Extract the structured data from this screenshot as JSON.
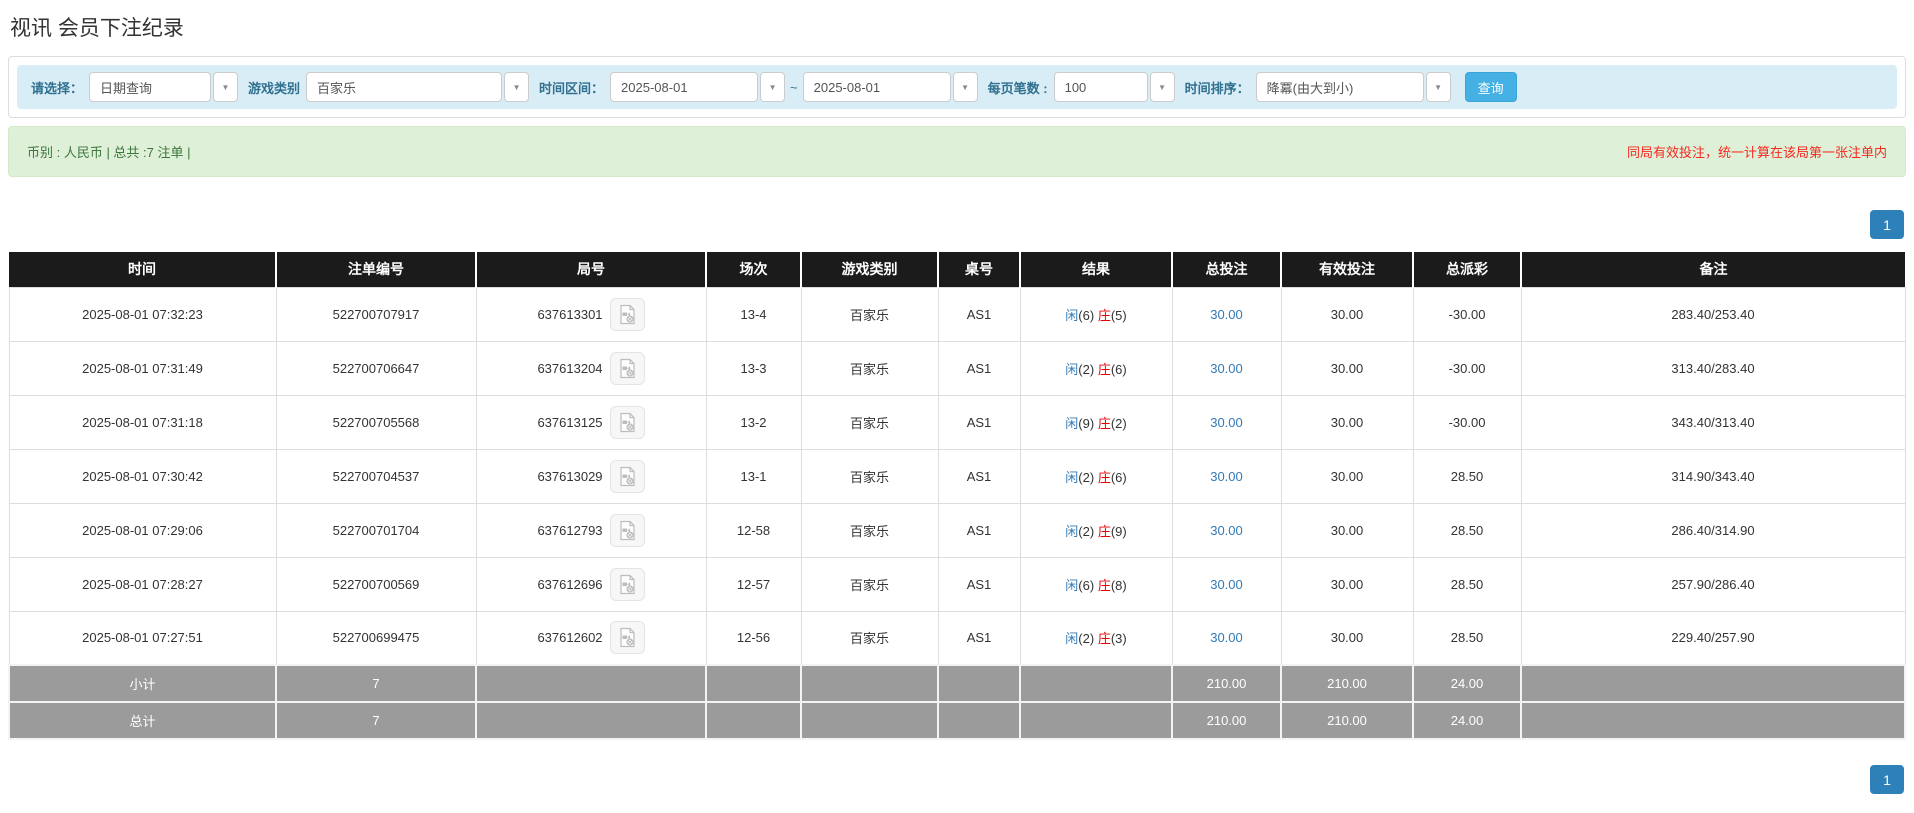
{
  "page": {
    "title": "视讯 会员下注纪录"
  },
  "filters": {
    "select_label": "请选择：",
    "select_value": "日期查询",
    "game_label": "游戏类别",
    "game_value": "百家乐",
    "range_label": "时间区间：",
    "date_from": "2025-08-01",
    "tilde": "~",
    "date_to": "2025-08-01",
    "per_page_label": "每页笔数 :",
    "per_page_value": "100",
    "sort_label": "时间排序：",
    "sort_value": "降冪(由大到小)",
    "search_button": "查询"
  },
  "summary_bar": {
    "left_text": "币别 : 人民币 | 总共 :7 注单 |",
    "right_note": "同局有效投注，统一计算在该局第一张注单内"
  },
  "pagination": {
    "page": "1"
  },
  "icons": {
    "dropdown_arrow": "▼",
    "video_replay": "film-document-icon"
  },
  "colors": {
    "header_bg": "#1b1b1b",
    "summary_row_bg": "#9b9b9b",
    "panel_blue": "#d9edf7",
    "label_blue": "#31708f",
    "link_blue": "#337ab7",
    "negative_red": "#e60000",
    "note_red": "#f5291f",
    "success_bg": "#dff0d8",
    "success_text": "#3c763d",
    "search_button_bg": "#45b0e3",
    "pagination_bg": "#2e80b9"
  },
  "table": {
    "headers": [
      "时间",
      "注单编号",
      "局号",
      "场次",
      "游戏类别",
      "桌号",
      "结果",
      "总投注",
      "有效投注",
      "总派彩",
      "备注"
    ],
    "rows": [
      {
        "time": "2025-08-01 07:32:23",
        "bet_id": "522700707917",
        "round_id": "637613301",
        "session": "13-4",
        "game_type": "百家乐",
        "table_no": "AS1",
        "player": "闲",
        "player_n": "(6)",
        "banker": "庄",
        "banker_n": "(5)",
        "total_bet": "30.00",
        "valid_bet": "30.00",
        "payout": "-30.00",
        "note": "283.40/253.40"
      },
      {
        "time": "2025-08-01 07:31:49",
        "bet_id": "522700706647",
        "round_id": "637613204",
        "session": "13-3",
        "game_type": "百家乐",
        "table_no": "AS1",
        "player": "闲",
        "player_n": "(2)",
        "banker": "庄",
        "banker_n": "(6)",
        "total_bet": "30.00",
        "valid_bet": "30.00",
        "payout": "-30.00",
        "note": "313.40/283.40"
      },
      {
        "time": "2025-08-01 07:31:18",
        "bet_id": "522700705568",
        "round_id": "637613125",
        "session": "13-2",
        "game_type": "百家乐",
        "table_no": "AS1",
        "player": "闲",
        "player_n": "(9)",
        "banker": "庄",
        "banker_n": "(2)",
        "total_bet": "30.00",
        "valid_bet": "30.00",
        "payout": "-30.00",
        "note": "343.40/313.40"
      },
      {
        "time": "2025-08-01 07:30:42",
        "bet_id": "522700704537",
        "round_id": "637613029",
        "session": "13-1",
        "game_type": "百家乐",
        "table_no": "AS1",
        "player": "闲",
        "player_n": "(2)",
        "banker": "庄",
        "banker_n": "(6)",
        "total_bet": "30.00",
        "valid_bet": "30.00",
        "payout": "28.50",
        "note": "314.90/343.40"
      },
      {
        "time": "2025-08-01 07:29:06",
        "bet_id": "522700701704",
        "round_id": "637612793",
        "session": "12-58",
        "game_type": "百家乐",
        "table_no": "AS1",
        "player": "闲",
        "player_n": "(2)",
        "banker": "庄",
        "banker_n": "(9)",
        "total_bet": "30.00",
        "valid_bet": "30.00",
        "payout": "28.50",
        "note": "286.40/314.90"
      },
      {
        "time": "2025-08-01 07:28:27",
        "bet_id": "522700700569",
        "round_id": "637612696",
        "session": "12-57",
        "game_type": "百家乐",
        "table_no": "AS1",
        "player": "闲",
        "player_n": "(6)",
        "banker": "庄",
        "banker_n": "(8)",
        "total_bet": "30.00",
        "valid_bet": "30.00",
        "payout": "28.50",
        "note": "257.90/286.40"
      },
      {
        "time": "2025-08-01 07:27:51",
        "bet_id": "522700699475",
        "round_id": "637612602",
        "session": "12-56",
        "game_type": "百家乐",
        "table_no": "AS1",
        "player": "闲",
        "player_n": "(2)",
        "banker": "庄",
        "banker_n": "(3)",
        "total_bet": "30.00",
        "valid_bet": "30.00",
        "payout": "28.50",
        "note": "229.40/257.90"
      }
    ],
    "subtotal": {
      "label": "小计",
      "count": "7",
      "total_bet": "210.00",
      "valid_bet": "210.00",
      "payout": "24.00"
    },
    "total": {
      "label": "总计",
      "count": "7",
      "total_bet": "210.00",
      "valid_bet": "210.00",
      "payout": "24.00"
    }
  }
}
